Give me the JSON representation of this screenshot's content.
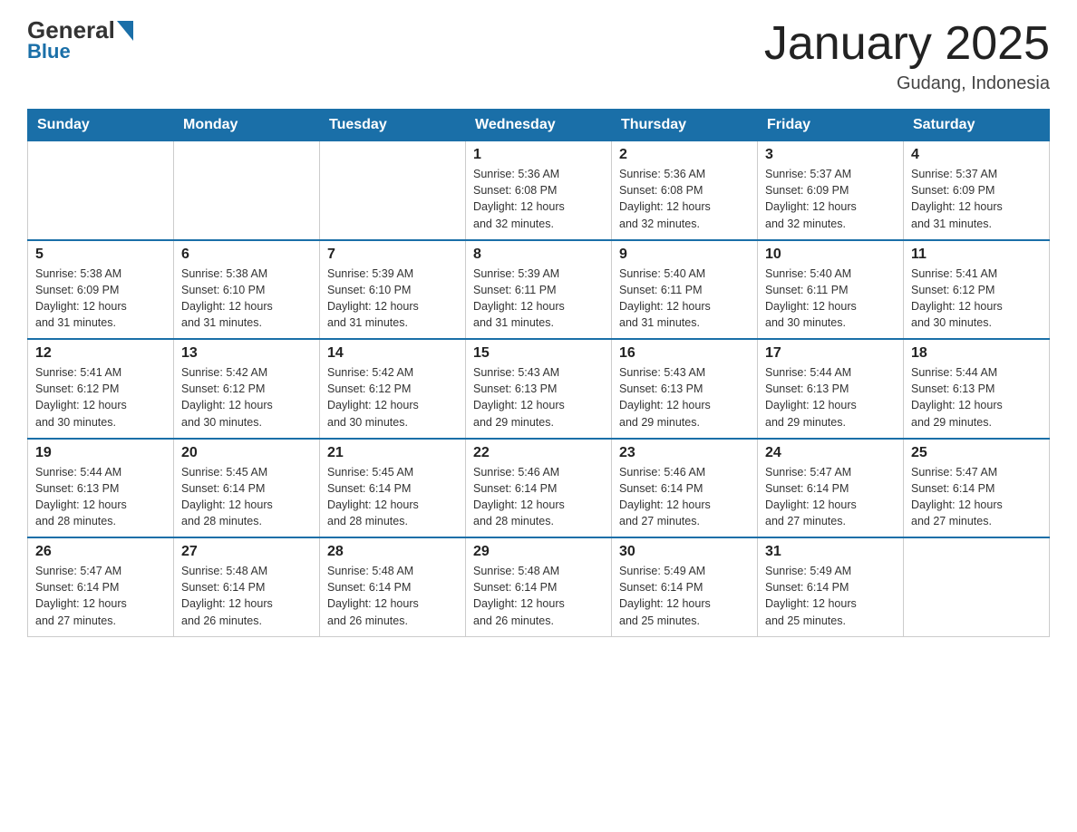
{
  "header": {
    "logo_general": "General",
    "logo_blue": "Blue",
    "month_title": "January 2025",
    "location": "Gudang, Indonesia"
  },
  "days_of_week": [
    "Sunday",
    "Monday",
    "Tuesday",
    "Wednesday",
    "Thursday",
    "Friday",
    "Saturday"
  ],
  "weeks": [
    [
      {
        "day": "",
        "info": ""
      },
      {
        "day": "",
        "info": ""
      },
      {
        "day": "",
        "info": ""
      },
      {
        "day": "1",
        "info": "Sunrise: 5:36 AM\nSunset: 6:08 PM\nDaylight: 12 hours\nand 32 minutes."
      },
      {
        "day": "2",
        "info": "Sunrise: 5:36 AM\nSunset: 6:08 PM\nDaylight: 12 hours\nand 32 minutes."
      },
      {
        "day": "3",
        "info": "Sunrise: 5:37 AM\nSunset: 6:09 PM\nDaylight: 12 hours\nand 32 minutes."
      },
      {
        "day": "4",
        "info": "Sunrise: 5:37 AM\nSunset: 6:09 PM\nDaylight: 12 hours\nand 31 minutes."
      }
    ],
    [
      {
        "day": "5",
        "info": "Sunrise: 5:38 AM\nSunset: 6:09 PM\nDaylight: 12 hours\nand 31 minutes."
      },
      {
        "day": "6",
        "info": "Sunrise: 5:38 AM\nSunset: 6:10 PM\nDaylight: 12 hours\nand 31 minutes."
      },
      {
        "day": "7",
        "info": "Sunrise: 5:39 AM\nSunset: 6:10 PM\nDaylight: 12 hours\nand 31 minutes."
      },
      {
        "day": "8",
        "info": "Sunrise: 5:39 AM\nSunset: 6:11 PM\nDaylight: 12 hours\nand 31 minutes."
      },
      {
        "day": "9",
        "info": "Sunrise: 5:40 AM\nSunset: 6:11 PM\nDaylight: 12 hours\nand 31 minutes."
      },
      {
        "day": "10",
        "info": "Sunrise: 5:40 AM\nSunset: 6:11 PM\nDaylight: 12 hours\nand 30 minutes."
      },
      {
        "day": "11",
        "info": "Sunrise: 5:41 AM\nSunset: 6:12 PM\nDaylight: 12 hours\nand 30 minutes."
      }
    ],
    [
      {
        "day": "12",
        "info": "Sunrise: 5:41 AM\nSunset: 6:12 PM\nDaylight: 12 hours\nand 30 minutes."
      },
      {
        "day": "13",
        "info": "Sunrise: 5:42 AM\nSunset: 6:12 PM\nDaylight: 12 hours\nand 30 minutes."
      },
      {
        "day": "14",
        "info": "Sunrise: 5:42 AM\nSunset: 6:12 PM\nDaylight: 12 hours\nand 30 minutes."
      },
      {
        "day": "15",
        "info": "Sunrise: 5:43 AM\nSunset: 6:13 PM\nDaylight: 12 hours\nand 29 minutes."
      },
      {
        "day": "16",
        "info": "Sunrise: 5:43 AM\nSunset: 6:13 PM\nDaylight: 12 hours\nand 29 minutes."
      },
      {
        "day": "17",
        "info": "Sunrise: 5:44 AM\nSunset: 6:13 PM\nDaylight: 12 hours\nand 29 minutes."
      },
      {
        "day": "18",
        "info": "Sunrise: 5:44 AM\nSunset: 6:13 PM\nDaylight: 12 hours\nand 29 minutes."
      }
    ],
    [
      {
        "day": "19",
        "info": "Sunrise: 5:44 AM\nSunset: 6:13 PM\nDaylight: 12 hours\nand 28 minutes."
      },
      {
        "day": "20",
        "info": "Sunrise: 5:45 AM\nSunset: 6:14 PM\nDaylight: 12 hours\nand 28 minutes."
      },
      {
        "day": "21",
        "info": "Sunrise: 5:45 AM\nSunset: 6:14 PM\nDaylight: 12 hours\nand 28 minutes."
      },
      {
        "day": "22",
        "info": "Sunrise: 5:46 AM\nSunset: 6:14 PM\nDaylight: 12 hours\nand 28 minutes."
      },
      {
        "day": "23",
        "info": "Sunrise: 5:46 AM\nSunset: 6:14 PM\nDaylight: 12 hours\nand 27 minutes."
      },
      {
        "day": "24",
        "info": "Sunrise: 5:47 AM\nSunset: 6:14 PM\nDaylight: 12 hours\nand 27 minutes."
      },
      {
        "day": "25",
        "info": "Sunrise: 5:47 AM\nSunset: 6:14 PM\nDaylight: 12 hours\nand 27 minutes."
      }
    ],
    [
      {
        "day": "26",
        "info": "Sunrise: 5:47 AM\nSunset: 6:14 PM\nDaylight: 12 hours\nand 27 minutes."
      },
      {
        "day": "27",
        "info": "Sunrise: 5:48 AM\nSunset: 6:14 PM\nDaylight: 12 hours\nand 26 minutes."
      },
      {
        "day": "28",
        "info": "Sunrise: 5:48 AM\nSunset: 6:14 PM\nDaylight: 12 hours\nand 26 minutes."
      },
      {
        "day": "29",
        "info": "Sunrise: 5:48 AM\nSunset: 6:14 PM\nDaylight: 12 hours\nand 26 minutes."
      },
      {
        "day": "30",
        "info": "Sunrise: 5:49 AM\nSunset: 6:14 PM\nDaylight: 12 hours\nand 25 minutes."
      },
      {
        "day": "31",
        "info": "Sunrise: 5:49 AM\nSunset: 6:14 PM\nDaylight: 12 hours\nand 25 minutes."
      },
      {
        "day": "",
        "info": ""
      }
    ]
  ]
}
